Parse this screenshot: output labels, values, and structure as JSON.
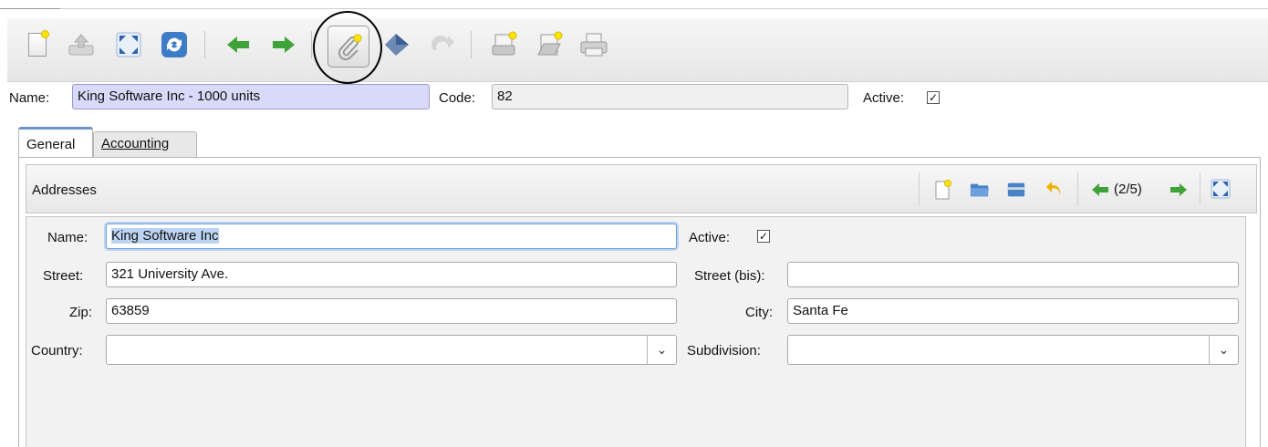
{
  "toolbar": {
    "icons": [
      "new-icon",
      "save-icon",
      "switch-view-icon",
      "reload-icon",
      "previous-icon",
      "next-icon",
      "attachment-icon",
      "action-icon",
      "relate-icon",
      "report-icon",
      "email-icon",
      "print-icon"
    ]
  },
  "header": {
    "name_label": "Name:",
    "name_value": "King Software Inc - 1000 units",
    "code_label": "Code:",
    "code_value": "82",
    "active_label": "Active:",
    "active_checked": "✓"
  },
  "tabs": [
    {
      "label": "General"
    },
    {
      "label": "Accounting"
    }
  ],
  "addresses": {
    "title": "Addresses",
    "pager": "(2/5)",
    "form": {
      "name_label": "Name:",
      "name_value": "King Software Inc",
      "active_label": "Active:",
      "active_checked": "✓",
      "street_label": "Street:",
      "street_value": "321 University Ave.",
      "street_bis_label": "Street (bis):",
      "street_bis_value": "",
      "zip_label": "Zip:",
      "zip_value": "63859",
      "city_label": "City:",
      "city_value": "Santa Fe",
      "country_label": "Country:",
      "country_value": "",
      "subdivision_label": "Subdivision:",
      "subdivision_value": "",
      "dropdown_glyph": "⌄"
    }
  },
  "colors": {
    "required_field": "#d9daf9",
    "readonly_field": "#f0f0f0",
    "green_arrow": "#3fa33a",
    "focus": "#6f9ed8"
  }
}
